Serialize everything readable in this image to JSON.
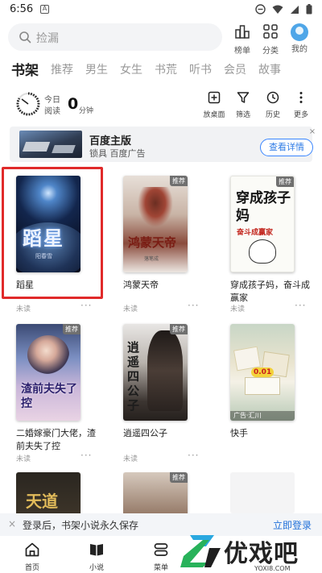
{
  "status_bar": {
    "time": "6:56",
    "notification_letter": "A"
  },
  "search": {
    "placeholder": "捡漏"
  },
  "top_actions": [
    {
      "label": "榜单",
      "icon": "ranking-icon"
    },
    {
      "label": "分类",
      "icon": "category-grid-icon"
    },
    {
      "label": "我的",
      "icon": "avatar-icon"
    }
  ],
  "tabs": [
    "书架",
    "推荐",
    "男生",
    "女生",
    "书荒",
    "听书",
    "会员",
    "故事"
  ],
  "active_tab": "书架",
  "reading_stats": {
    "today_label": "今日",
    "read_label": "阅读",
    "minutes_value": "0",
    "minutes_unit": "分钟"
  },
  "tools": [
    {
      "label": "放桌面",
      "icon": "add-to-desktop-icon"
    },
    {
      "label": "筛选",
      "icon": "filter-icon"
    },
    {
      "label": "历史",
      "icon": "history-icon"
    },
    {
      "label": "更多",
      "icon": "more-vertical-icon"
    }
  ],
  "ad": {
    "title": "百度主版",
    "subtitle": "锁具 百度广告",
    "button": "查看详情",
    "close": "×"
  },
  "books": [
    {
      "title": "蹈星",
      "cover_title": "蹈星",
      "cover_author": "阳春雪",
      "status": "未读",
      "badge": "",
      "selected": true
    },
    {
      "title": "鸿蒙天帝",
      "cover_title": "鸿蒙天帝",
      "cover_author": "落笔成",
      "status": "未读",
      "badge": "推荐",
      "selected": false
    },
    {
      "title": "穿成孩子妈，奋斗成赢家",
      "cover_title": "穿成孩子妈",
      "cover_subtitle": "奋斗成赢家",
      "status": "未读",
      "badge": "推荐",
      "selected": false
    },
    {
      "title": "二婚嫁豪门大佬，渣前夫失了控",
      "cover_title": "渣前夫失了控",
      "status": "未读",
      "badge": "推荐",
      "selected": false
    },
    {
      "title": "逍遥四公子",
      "cover_title": "逍遥四公子",
      "status": "未读",
      "badge": "推荐",
      "selected": false
    },
    {
      "title": "快手",
      "cover_title": "",
      "cover_label": "广告·汇川",
      "cover_price": "0.01",
      "status": "",
      "badge": "",
      "selected": false
    },
    {
      "title": "",
      "cover_title": "天道",
      "status": "",
      "badge": "推荐",
      "selected": false
    },
    {
      "title": "",
      "cover_title": "",
      "status": "",
      "badge": "推荐",
      "selected": false
    }
  ],
  "more_dots": "···",
  "login_banner": {
    "close": "×",
    "text": "登录后，书架小说永久保存",
    "button": "立即登录"
  },
  "bottom_nav": [
    {
      "label": "首页",
      "icon": "home-icon"
    },
    {
      "label": "小说",
      "icon": "book-icon"
    },
    {
      "label": "菜单",
      "icon": "menu-icon"
    }
  ],
  "watermark": {
    "text": "优戏吧",
    "url": "YOXI8.COM"
  },
  "colors": {
    "accent": "#2e7be6",
    "highlight": "#e02a2a"
  }
}
